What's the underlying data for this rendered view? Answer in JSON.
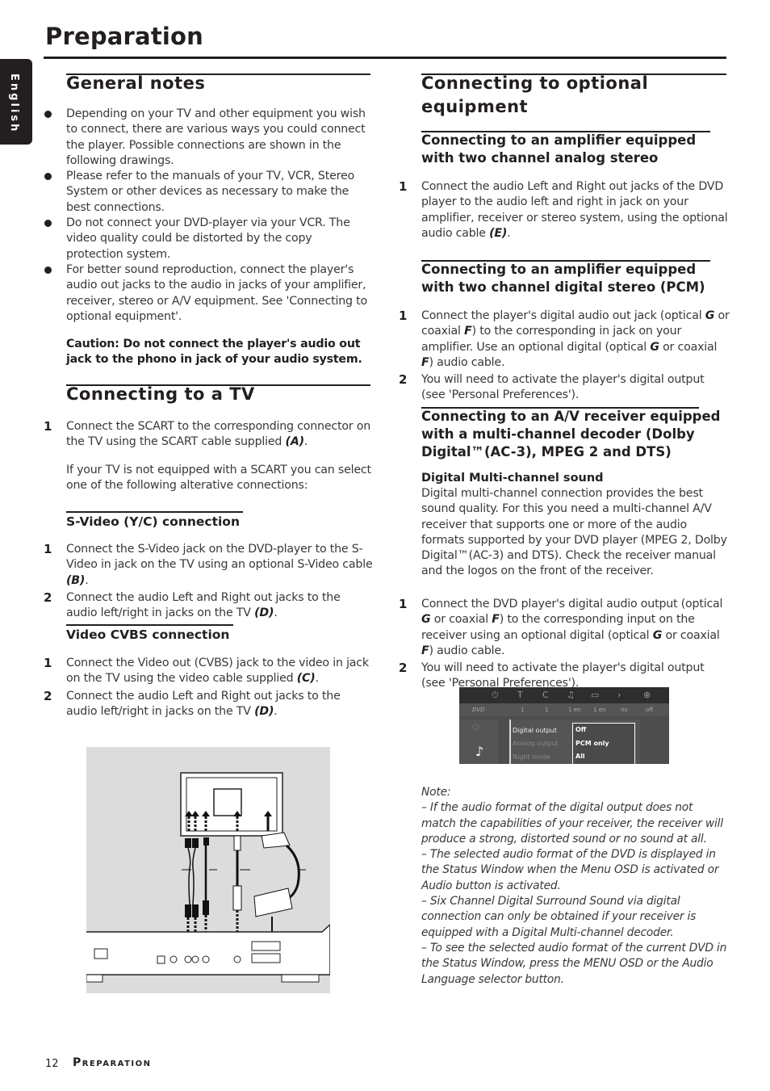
{
  "page": {
    "title": "Preparation",
    "language_tab": "English",
    "footer": {
      "page_number": "12",
      "section": "Preparation"
    }
  },
  "general_notes": {
    "heading": "General notes",
    "bullets": [
      "Depending on your TV and other equipment you wish to connect, there are various ways you could connect the player. Possible connections are shown in the following drawings.",
      "Please refer to the manuals of your TV, VCR, Stereo System or other devices as necessary to make the best connections.",
      "Do not connect your DVD-player via your VCR. The video quality could be distorted by the copy protection system.",
      "For better sound reproduction, connect the player's audio out jacks to the audio in jacks of your amplifier, receiver, stereo or A/V equipment. See 'Connecting to optional equipment'."
    ],
    "caution": "Caution:  Do not connect  the player's audio out jack to the phono in jack of your audio system."
  },
  "connecting_tv": {
    "heading": "Connecting to a TV",
    "step1": {
      "num": "1",
      "text": "Connect the SCART to the corresponding connector on the TV using the SCART cable supplied ",
      "ref": "(A)",
      "end": "."
    },
    "alt_text": "If your TV is not equipped with a SCART you can select one of the following alterative connections:",
    "svideo": {
      "heading": "S-Video (Y/C) connection",
      "steps": [
        {
          "num": "1",
          "text": "Connect the S-Video jack on the DVD-player to the S-Video in jack on the TV using an optional S-Video cable ",
          "ref": "(B)",
          "end": "."
        },
        {
          "num": "2",
          "text": "Connect the audio Left and Right out jacks to the audio left/right in jacks on the TV ",
          "ref": "(D)",
          "end": "."
        }
      ]
    },
    "cvbs": {
      "heading": "Video CVBS connection",
      "steps": [
        {
          "num": "1",
          "text": "Connect the Video out (CVBS) jack to the video in jack on the TV using the video cable supplied ",
          "ref": "(C)",
          "end": "."
        },
        {
          "num": "2",
          "text": "Connect the audio Left and Right out jacks to the audio left/right in jacks on the TV ",
          "ref": "(D)",
          "end": "."
        }
      ]
    }
  },
  "optional": {
    "heading": "Connecting to optional equipment",
    "analog": {
      "heading": "Connecting to an amplifier equipped with two channel analog stereo",
      "step1": {
        "num": "1",
        "text": "Connect the audio Left and Right out jacks of the DVD player to the audio left and right in jack on your amplifier, receiver or stereo system,  using the optional audio cable ",
        "ref": "(E)",
        "end": "."
      }
    },
    "pcm": {
      "heading": "Connecting to an amplifier equipped with two channel digital stereo (PCM)",
      "step1": {
        "num": "1",
        "a": "Connect the player's digital audio out jack (optical ",
        "g": "G",
        "b": " or coaxial ",
        "f": "F",
        "c": ") to the corresponding in jack on your amplifier. Use an optional digital (optical ",
        "g2": "G",
        "d": " or coaxial ",
        "f2": "F",
        "e": ") audio cable."
      },
      "step2": {
        "num": "2",
        "text": "You will need to activate the player's digital output (see 'Personal Preferences')."
      }
    },
    "multichannel": {
      "heading": "Connecting to an A/V receiver equipped with a multi-channel decoder (Dolby Digital™(AC-3), MPEG 2 and DTS)",
      "subheading": "Digital Multi-channel sound",
      "description": "Digital multi-channel connection provides the best sound quality. For this you need a multi-channel A/V receiver that supports one or more of the audio formats supported by your DVD player (MPEG 2, Dolby Digital™(AC-3) and DTS). Check the receiver manual and the logos on the front of the receiver.",
      "step1": {
        "num": "1",
        "a": "Connect the DVD player's digital audio output (optical ",
        "g": "G",
        "b": " or coaxial ",
        "f": "F",
        "c": ") to the corresponding input on the receiver using an optional digital (optical ",
        "g2": "G",
        "d": " or coaxial ",
        "f2": "F",
        "e": ") audio cable."
      },
      "step2": {
        "num": "2",
        "text": "You will need to activate the player's digital output (see 'Personal Preferences')."
      }
    },
    "osd": {
      "top_icons": [
        "timer-icon",
        "T",
        "C",
        "audio-icon",
        "subtitle-icon",
        "angle-icon",
        "zoom-icon"
      ],
      "top_values": [
        "DVD",
        "1",
        "1",
        "1 en",
        "1 en",
        "no",
        "off"
      ],
      "menu_items": [
        "Digital output",
        "Analog output",
        "Night mode"
      ],
      "options": [
        "Off",
        "PCM only",
        "All"
      ]
    },
    "notes": {
      "label": "Note:",
      "items": [
        "–  If the audio format of the digital output does not match the capabilities of your receiver, the receiver will produce a strong, distorted sound or no sound at all.",
        "–  The selected audio format of the DVD is displayed in the Status Window when the Menu OSD is activated or Audio button is activated.",
        "–  Six Channel Digital Surround Sound via digital connection can only be obtained if your receiver is equipped with a Digital Multi-channel decoder.",
        "–  To see the selected audio format of the current DVD in the Status Window, press the MENU OSD or the Audio Language selector button."
      ]
    }
  }
}
